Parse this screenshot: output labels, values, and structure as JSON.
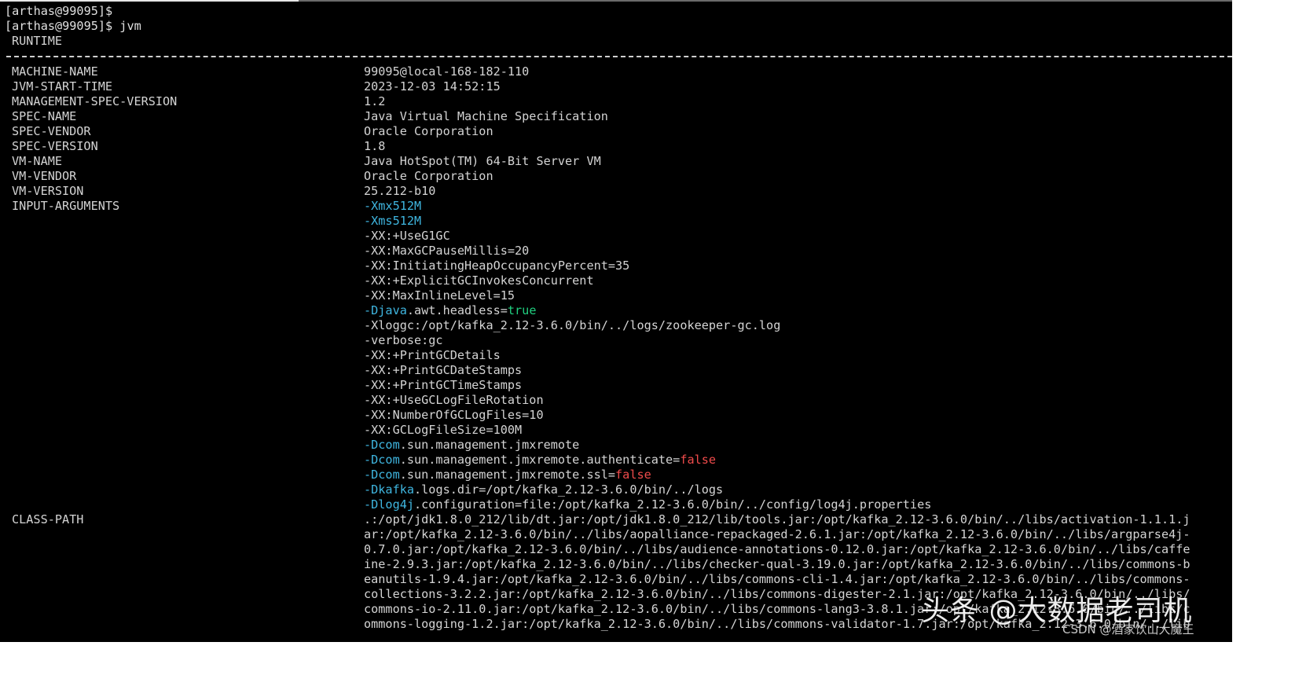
{
  "terminal": {
    "prompt_lines": [
      "[arthas@99095]$",
      "[arthas@99095]$ jvm"
    ],
    "section_title": "RUNTIME",
    "rows": [
      {
        "key": "MACHINE-NAME",
        "value": "99095@local-168-182-110"
      },
      {
        "key": "JVM-START-TIME",
        "value": "2023-12-03 14:52:15"
      },
      {
        "key": "MANAGEMENT-SPEC-VERSION",
        "value": "1.2"
      },
      {
        "key": "SPEC-NAME",
        "value": "Java Virtual Machine Specification"
      },
      {
        "key": "SPEC-VENDOR",
        "value": "Oracle Corporation"
      },
      {
        "key": "SPEC-VERSION",
        "value": "1.8"
      },
      {
        "key": "VM-NAME",
        "value": "Java HotSpot(TM) 64-Bit Server VM"
      },
      {
        "key": "VM-VENDOR",
        "value": "Oracle Corporation"
      },
      {
        "key": "VM-VERSION",
        "value": "25.212-b10"
      }
    ],
    "input_arguments_key": "INPUT-ARGUMENTS",
    "input_arguments": [
      [
        {
          "t": "-Xmx512M",
          "c": "cyan"
        }
      ],
      [
        {
          "t": "-Xms512M",
          "c": "cyan"
        }
      ],
      [
        {
          "t": "-XX:+UseG1GC",
          "c": ""
        }
      ],
      [
        {
          "t": "-XX:MaxGCPauseMillis=20",
          "c": ""
        }
      ],
      [
        {
          "t": "-XX:InitiatingHeapOccupancyPercent=35",
          "c": ""
        }
      ],
      [
        {
          "t": "-XX:+ExplicitGCInvokesConcurrent",
          "c": ""
        }
      ],
      [
        {
          "t": "-XX:MaxInlineLevel=15",
          "c": ""
        }
      ],
      [
        {
          "t": "-Djava",
          "c": "cyan"
        },
        {
          "t": ".awt.headless=",
          "c": ""
        },
        {
          "t": "true",
          "c": "green"
        }
      ],
      [
        {
          "t": "-Xloggc:/opt/kafka_2.12-3.6.0/bin/../logs/zookeeper-gc.log",
          "c": ""
        }
      ],
      [
        {
          "t": "-verbose:gc",
          "c": ""
        }
      ],
      [
        {
          "t": "-XX:+PrintGCDetails",
          "c": ""
        }
      ],
      [
        {
          "t": "-XX:+PrintGCDateStamps",
          "c": ""
        }
      ],
      [
        {
          "t": "-XX:+PrintGCTimeStamps",
          "c": ""
        }
      ],
      [
        {
          "t": "-XX:+UseGCLogFileRotation",
          "c": ""
        }
      ],
      [
        {
          "t": "-XX:NumberOfGCLogFiles=10",
          "c": ""
        }
      ],
      [
        {
          "t": "-XX:GCLogFileSize=100M",
          "c": ""
        }
      ],
      [
        {
          "t": "-Dcom",
          "c": "cyan"
        },
        {
          "t": ".sun.management.jmxremote",
          "c": ""
        }
      ],
      [
        {
          "t": "-Dcom",
          "c": "cyan"
        },
        {
          "t": ".sun.management.jmxremote.authenticate=",
          "c": ""
        },
        {
          "t": "false",
          "c": "red"
        }
      ],
      [
        {
          "t": "-Dcom",
          "c": "cyan"
        },
        {
          "t": ".sun.management.jmxremote.ssl=",
          "c": ""
        },
        {
          "t": "false",
          "c": "red"
        }
      ],
      [
        {
          "t": "-Dkafka",
          "c": "cyan"
        },
        {
          "t": ".logs.dir=/opt/kafka_2.12-3.6.0/bin/../logs",
          "c": ""
        }
      ],
      [
        {
          "t": "-Dlog4j",
          "c": "cyan"
        },
        {
          "t": ".configuration=file:/opt/kafka_2.12-3.6.0/bin/../config/log4j.properties",
          "c": ""
        }
      ]
    ],
    "class_path_key": "CLASS-PATH",
    "class_path_lines": [
      ".:/opt/jdk1.8.0_212/lib/dt.jar:/opt/jdk1.8.0_212/lib/tools.jar:/opt/kafka_2.12-3.6.0/bin/../libs/activation-1.1.1.j",
      "ar:/opt/kafka_2.12-3.6.0/bin/../libs/aopalliance-repackaged-2.6.1.jar:/opt/kafka_2.12-3.6.0/bin/../libs/argparse4j-",
      "0.7.0.jar:/opt/kafka_2.12-3.6.0/bin/../libs/audience-annotations-0.12.0.jar:/opt/kafka_2.12-3.6.0/bin/../libs/caffe",
      "ine-2.9.3.jar:/opt/kafka_2.12-3.6.0/bin/../libs/checker-qual-3.19.0.jar:/opt/kafka_2.12-3.6.0/bin/../libs/commons-b",
      "eanutils-1.9.4.jar:/opt/kafka_2.12-3.6.0/bin/../libs/commons-cli-1.4.jar:/opt/kafka_2.12-3.6.0/bin/../libs/commons-",
      "collections-3.2.2.jar:/opt/kafka_2.12-3.6.0/bin/../libs/commons-digester-2.1.jar:/opt/kafka_2.12-3.6.0/bin/../libs/",
      "commons-io-2.11.0.jar:/opt/kafka_2.12-3.6.0/bin/../libs/commons-lang3-3.8.1.jar:/opt/kafka_2.12-3.6.0/bin/../libs/c",
      "ommons-logging-1.2.jar:/opt/kafka_2.12-3.6.0/bin/../libs/commons-validator-1.7.jar:/opt/kafka_2.12-3.6.0/bin/../lib"
    ],
    "watermark": "头条 @大数据老司机",
    "watermark_small": "CSDN @酒家饮山大魔王"
  }
}
